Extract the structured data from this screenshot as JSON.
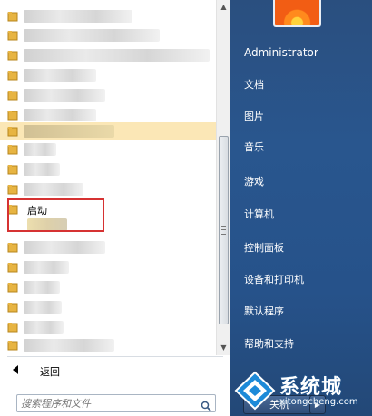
{
  "start_menu": {
    "programs": {
      "startup_label": "启动",
      "highlighted_row": 6,
      "back_label": "返回"
    },
    "search": {
      "placeholder": "搜索程序和文件"
    },
    "right_menu": {
      "user_name": "Administrator",
      "items": [
        "文档",
        "图片",
        "音乐",
        "游戏",
        "计算机",
        "控制面板",
        "设备和打印机",
        "默认程序",
        "帮助和支持"
      ]
    },
    "shutdown_label": "关机"
  },
  "watermark": {
    "title": "系统城",
    "subtitle": "xitongcheng.com"
  },
  "colors": {
    "highlight": "#fbe7b6",
    "annotation_red": "#d63232",
    "right_panel": "#29568e"
  }
}
